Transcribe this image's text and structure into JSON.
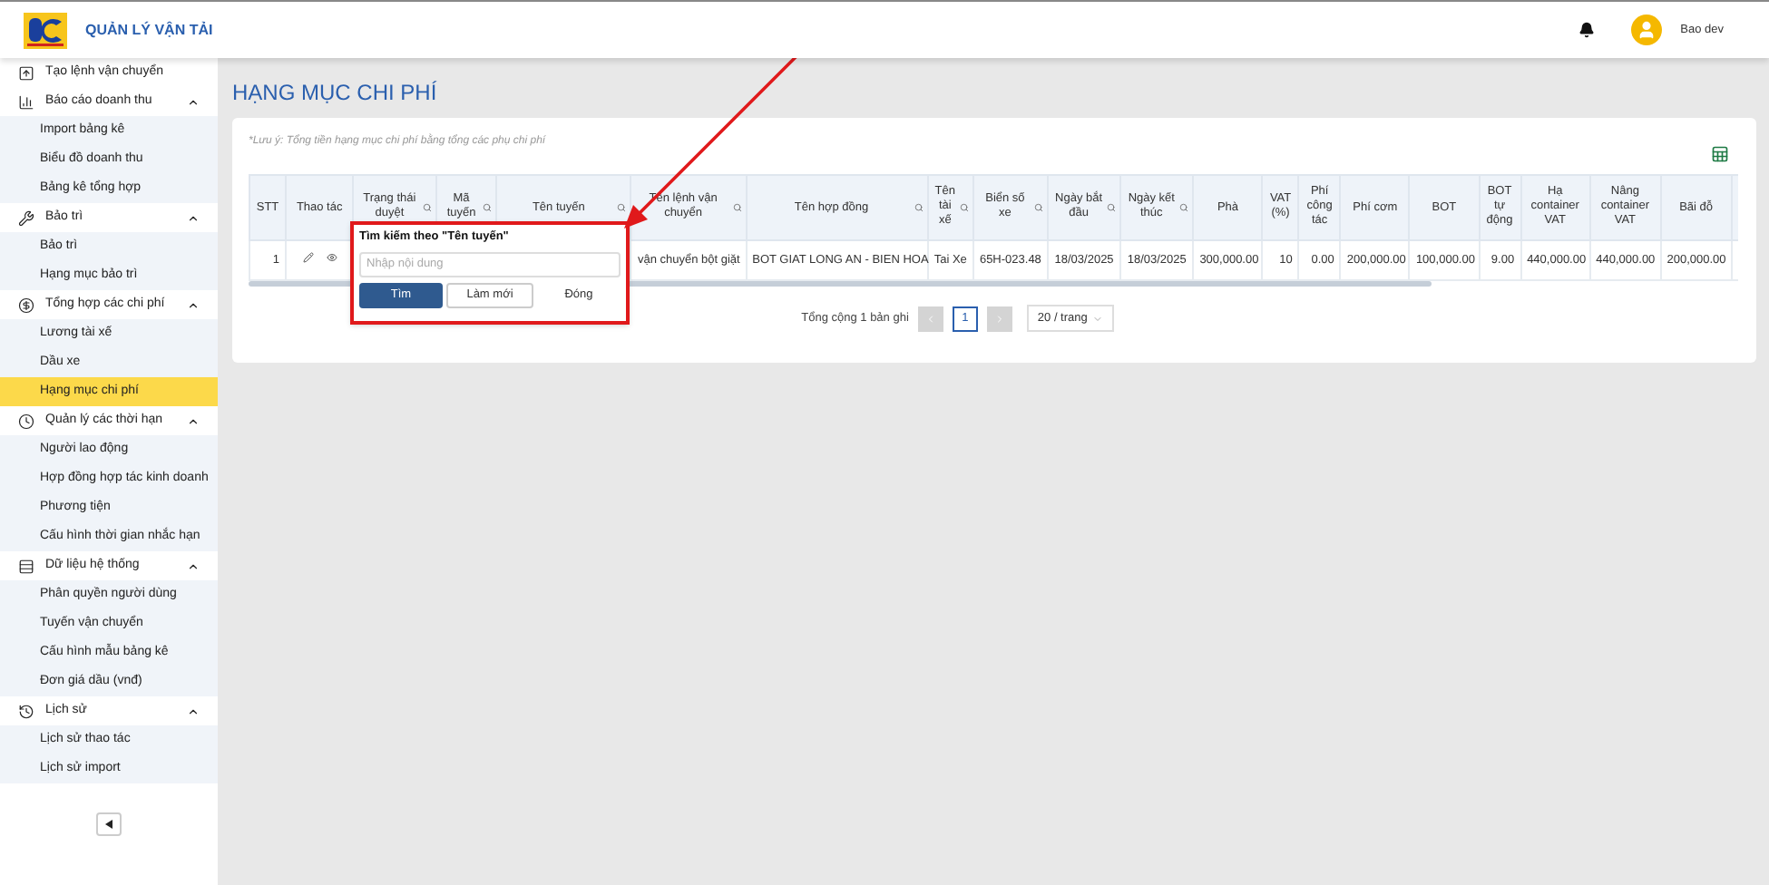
{
  "app": {
    "title": "QUẢN LÝ VẬN TẢI",
    "user": "Bao dev"
  },
  "sidebar": {
    "items": [
      {
        "label": "Tạo lệnh vận chuyển"
      },
      {
        "label": "Báo cáo doanh thu",
        "expanded": true,
        "children": [
          {
            "label": "Import bảng kê",
            "selected": false
          },
          {
            "label": "Biểu đồ doanh thu",
            "selected": false
          },
          {
            "label": "Bảng kê tổng hợp",
            "selected": false
          }
        ]
      },
      {
        "label": "Bảo trì",
        "expanded": true,
        "children": [
          {
            "label": "Bảo trì",
            "selected": false
          },
          {
            "label": "Hạng mục bảo trì",
            "selected": false
          }
        ]
      },
      {
        "label": "Tổng hợp các chi phí",
        "expanded": true,
        "children": [
          {
            "label": "Lương tài xế",
            "selected": false
          },
          {
            "label": "Dầu xe",
            "selected": false
          },
          {
            "label": "Hạng mục chi phí",
            "selected": true
          }
        ]
      },
      {
        "label": "Quản lý các thời hạn",
        "expanded": true,
        "children": [
          {
            "label": "Người lao động",
            "selected": false
          },
          {
            "label": "Hợp đồng hợp tác kinh doanh",
            "selected": false
          },
          {
            "label": "Phương tiện",
            "selected": false
          },
          {
            "label": "Cấu hình thời gian nhắc hạn",
            "selected": false
          }
        ]
      },
      {
        "label": "Dữ liệu hệ thống",
        "expanded": true,
        "children": [
          {
            "label": "Phân quyền người dùng",
            "selected": false
          },
          {
            "label": "Tuyến vận chuyển",
            "selected": false
          },
          {
            "label": "Cấu hình mẫu bảng kê",
            "selected": false
          },
          {
            "label": "Đơn giá dầu (vnđ)",
            "selected": false
          }
        ]
      },
      {
        "label": "Lịch sử",
        "expanded": true,
        "children": [
          {
            "label": "Lịch sử thao tác",
            "selected": false
          },
          {
            "label": "Lịch sử import",
            "selected": false
          }
        ]
      }
    ]
  },
  "page": {
    "title": "HẠNG MỤC CHI PHÍ",
    "note": "*Lưu ý: Tổng tiền hạng mục chi phí bằng tổng các phụ chi phí"
  },
  "table": {
    "columns": [
      {
        "label": "STT",
        "kind": "number",
        "searchable": false
      },
      {
        "label": "Thao tác",
        "kind": "actions",
        "searchable": false
      },
      {
        "label": "Trạng thái duyệt",
        "kind": "text",
        "searchable": true
      },
      {
        "label": "Mã tuyến",
        "kind": "text",
        "searchable": true
      },
      {
        "label": "Tên tuyến",
        "kind": "text",
        "searchable": true
      },
      {
        "label": "Tên lệnh vận chuyển",
        "kind": "text",
        "searchable": true
      },
      {
        "label": "Tên hợp đồng",
        "kind": "text",
        "searchable": true
      },
      {
        "label": "Tên tài xế",
        "kind": "text",
        "searchable": true
      },
      {
        "label": "Biển số xe",
        "kind": "text",
        "searchable": true
      },
      {
        "label": "Ngày bắt đầu",
        "kind": "text",
        "searchable": true
      },
      {
        "label": "Ngày kết thúc",
        "kind": "text",
        "searchable": true
      },
      {
        "label": "Phà",
        "kind": "number",
        "searchable": false
      },
      {
        "label": "VAT (%)",
        "kind": "number",
        "searchable": false
      },
      {
        "label": "Phí công tác",
        "kind": "number",
        "searchable": false
      },
      {
        "label": "Phí cơm",
        "kind": "number",
        "searchable": false
      },
      {
        "label": "BOT",
        "kind": "number",
        "searchable": false
      },
      {
        "label": "BOT tự động",
        "kind": "number",
        "searchable": false
      },
      {
        "label": "Hạ container VAT",
        "kind": "number",
        "searchable": false
      },
      {
        "label": "Nâng container VAT",
        "kind": "number",
        "searchable": false
      },
      {
        "label": "Bãi đỗ",
        "kind": "number",
        "searchable": false
      }
    ],
    "rows": [
      {
        "cells": [
          "1",
          null,
          null,
          null,
          null,
          "vận chuyển bột giặt",
          "BOT GIAT LONG AN - BIEN HOA",
          "Tai Xe",
          "65H-023.48",
          "18/03/2025",
          "18/03/2025",
          "300,000.00",
          "10",
          "0.00",
          "200,000.00",
          "100,000.00",
          "9.00",
          "440,000.00",
          "440,000.00",
          "200,000.00"
        ]
      }
    ]
  },
  "filter_popup": {
    "title": "Tìm kiếm theo \"Tên tuyến\"",
    "placeholder": "Nhập nội dung",
    "buttons": [
      {
        "label": "Tìm",
        "kind": "primary"
      },
      {
        "label": "Làm mới",
        "kind": "outline"
      },
      {
        "label": "Đóng",
        "kind": "text"
      }
    ]
  },
  "pagination": {
    "total": "Tổng cộng 1 bản ghi",
    "pages": [
      {
        "label": "1",
        "selected": true
      }
    ],
    "page_size": "20 / trang"
  }
}
